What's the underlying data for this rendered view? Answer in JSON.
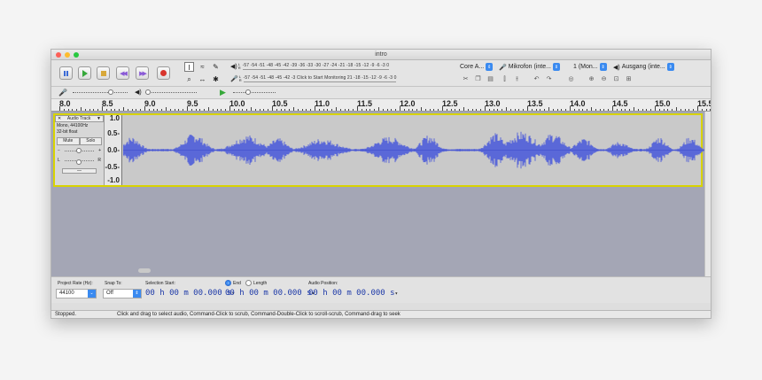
{
  "window": {
    "title": "intro"
  },
  "meters": {
    "record": {
      "lr": "L\nR",
      "scale": "-57 -54 -51 -48 -45 -42 -39 -36 -33 -30 -27 -24 -21 -18 -15 -12  -9  -6  -3  0"
    },
    "play": {
      "lr": "L\nR",
      "scale": "-57 -54 -51 -48 -45 -42 -3 Click to Start Monitoring 21 -18 -15 -12  -9  -6  -3  0"
    }
  },
  "devices": {
    "host": "Core A...",
    "input": "Mikrofon (inte...",
    "channels": "1 (Mon...",
    "output": "Ausgang (inte..."
  },
  "ruler": {
    "labels": [
      "8.0",
      "8.5",
      "9.0",
      "9.5",
      "10.0",
      "10.5",
      "11.0",
      "11.5",
      "12.0",
      "12.5",
      "13.0",
      "13.5",
      "14.0",
      "14.5",
      "15.0",
      "15.5"
    ]
  },
  "track": {
    "name": "Audio Track",
    "info_line1": "Mono, 44100Hz",
    "info_line2": "32-bit float",
    "mute": "Mute",
    "solo": "Solo",
    "gain_minus": "−",
    "gain_plus": "+",
    "pan_left": "L",
    "pan_right": "R",
    "collapse": "—",
    "vruler": [
      "1.0",
      "0.5-",
      "0.0-",
      "-0.5-",
      "-1.0"
    ]
  },
  "selection_bar": {
    "project_rate_label": "Project Rate (Hz):",
    "project_rate_value": "44100",
    "snap_to_label": "Snap To:",
    "snap_to_value": "Off",
    "selection_start_label": "Selection Start:",
    "end_label": "End",
    "length_label": "Length",
    "audio_position_label": "Audio Position:",
    "time_start": "00 h 00 m 00.000 s",
    "time_end": "00 h 00 m 00.000 s",
    "time_position": "00 h 00 m 00.000 s"
  },
  "status": {
    "state": "Stopped.",
    "hint": "Click and drag to select audio, Command-Click to scrub, Command-Double-Click to scroll-scrub, Command-drag to seek"
  },
  "colors": {
    "wave": "#5a68d8",
    "selection_border": "#d8d300",
    "track_bg": "#c9c9c9"
  }
}
